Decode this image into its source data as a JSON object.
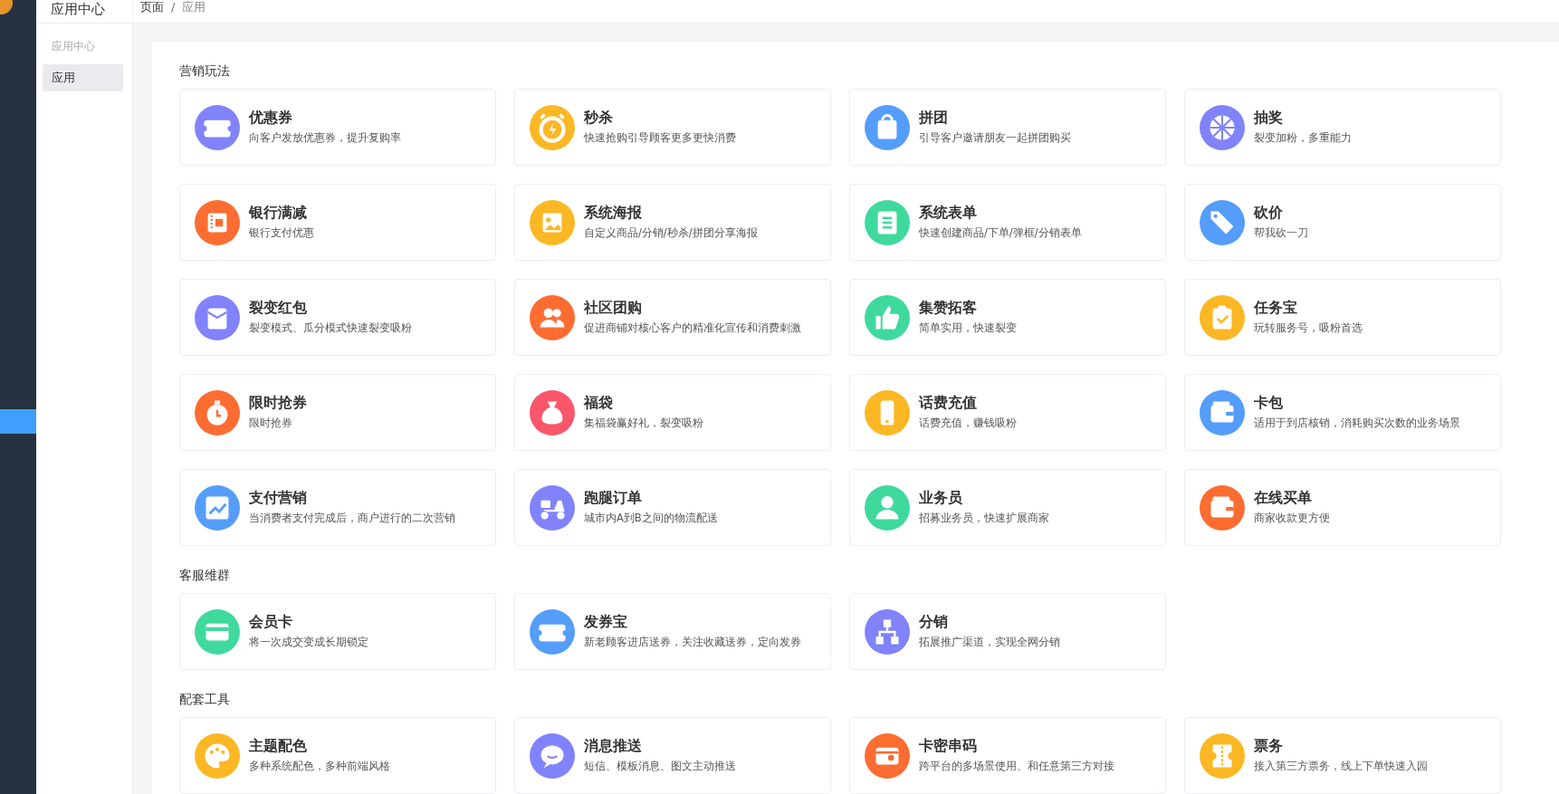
{
  "top_bar": {
    "title": "应用中心",
    "breadcrumb": [
      {
        "label": "页面"
      },
      {
        "label": "应用"
      }
    ],
    "separator": "/"
  },
  "sidebar": {
    "heading": "应用中心",
    "items": [
      {
        "label": "应用",
        "selected": true
      }
    ]
  },
  "sections": [
    {
      "heading": "营销玩法",
      "apps": [
        {
          "title": "优惠券",
          "description": "向客户发放优惠券，提升复购率",
          "color": "#8083fb"
        },
        {
          "title": "秒杀",
          "description": "快速抢购引导顾客更多更快消费",
          "color": "#fbb724"
        },
        {
          "title": "拼团",
          "description": "引导客户邀请朋友一起拼团购买",
          "color": "#559dfa"
        },
        {
          "title": "抽奖",
          "description": "裂变加粉，多重能力",
          "color": "#8083fb"
        },
        {
          "title": "银行满减",
          "description": "银行支付优惠",
          "color": "#fd6c31"
        },
        {
          "title": "系统海报",
          "description": "自定义商品/分销/秒杀/拼团分享海报",
          "color": "#fbb724"
        },
        {
          "title": "系统表单",
          "description": "快速创建商品/下单/弹框/分销表单",
          "color": "#3fd99e"
        },
        {
          "title": "砍价",
          "description": "帮我砍一刀",
          "color": "#559dfa"
        },
        {
          "title": "裂变红包",
          "description": "裂变模式、瓜分模式快速裂变吸粉",
          "color": "#8083fb"
        },
        {
          "title": "社区团购",
          "description": "促进商铺对核心客户的精准化宣传和消费刺激",
          "color": "#fd6c31"
        },
        {
          "title": "集赞拓客",
          "description": "简单实用，快速裂变",
          "color": "#3fd99e"
        },
        {
          "title": "任务宝",
          "description": "玩转服务号，吸粉首选",
          "color": "#fbb724"
        },
        {
          "title": "限时抢券",
          "description": "限时抢券",
          "color": "#fd6c31"
        },
        {
          "title": "福袋",
          "description": "集福袋赢好礼，裂变吸粉",
          "color": "#fa566b"
        },
        {
          "title": "话费充值",
          "description": "话费充值，赚钱吸粉",
          "color": "#fbb724"
        },
        {
          "title": "卡包",
          "description": "适用于到店核销，消耗购买次数的业务场景",
          "color": "#559dfa"
        },
        {
          "title": "支付营销",
          "description": "当消费者支付完成后，商户进行的二次营销",
          "color": "#559dfa"
        },
        {
          "title": "跑腿订单",
          "description": "城市内A到B之间的物流配送",
          "color": "#8083fb"
        },
        {
          "title": "业务员",
          "description": "招募业务员，快速扩展商家",
          "color": "#3fd99e"
        },
        {
          "title": "在线买单",
          "description": "商家收款更方便",
          "color": "#fd6c31"
        }
      ]
    },
    {
      "heading": "客服维群",
      "apps": [
        {
          "title": "会员卡",
          "description": "将一次成交变成长期锁定",
          "color": "#3fd99e"
        },
        {
          "title": "发券宝",
          "description": "新老顾客进店送券，关注收藏送券，定向发券",
          "color": "#559dfa"
        },
        {
          "title": "分销",
          "description": "拓展推广渠道，实现全网分销",
          "color": "#8083fb"
        }
      ]
    },
    {
      "heading": "配套工具",
      "apps": [
        {
          "title": "主题配色",
          "description": "多种系统配色，多种前端风格",
          "color": "#fbb724"
        },
        {
          "title": "消息推送",
          "description": "短信、模板消息、图文主动推送",
          "color": "#8083fb"
        },
        {
          "title": "卡密串码",
          "description": "跨平台的多场景使用、和任意第三方对接",
          "color": "#fd6c31"
        },
        {
          "title": "票务",
          "description": "接入第三方票务，线上下单快速入园",
          "color": "#fbb724"
        }
      ]
    }
  ]
}
